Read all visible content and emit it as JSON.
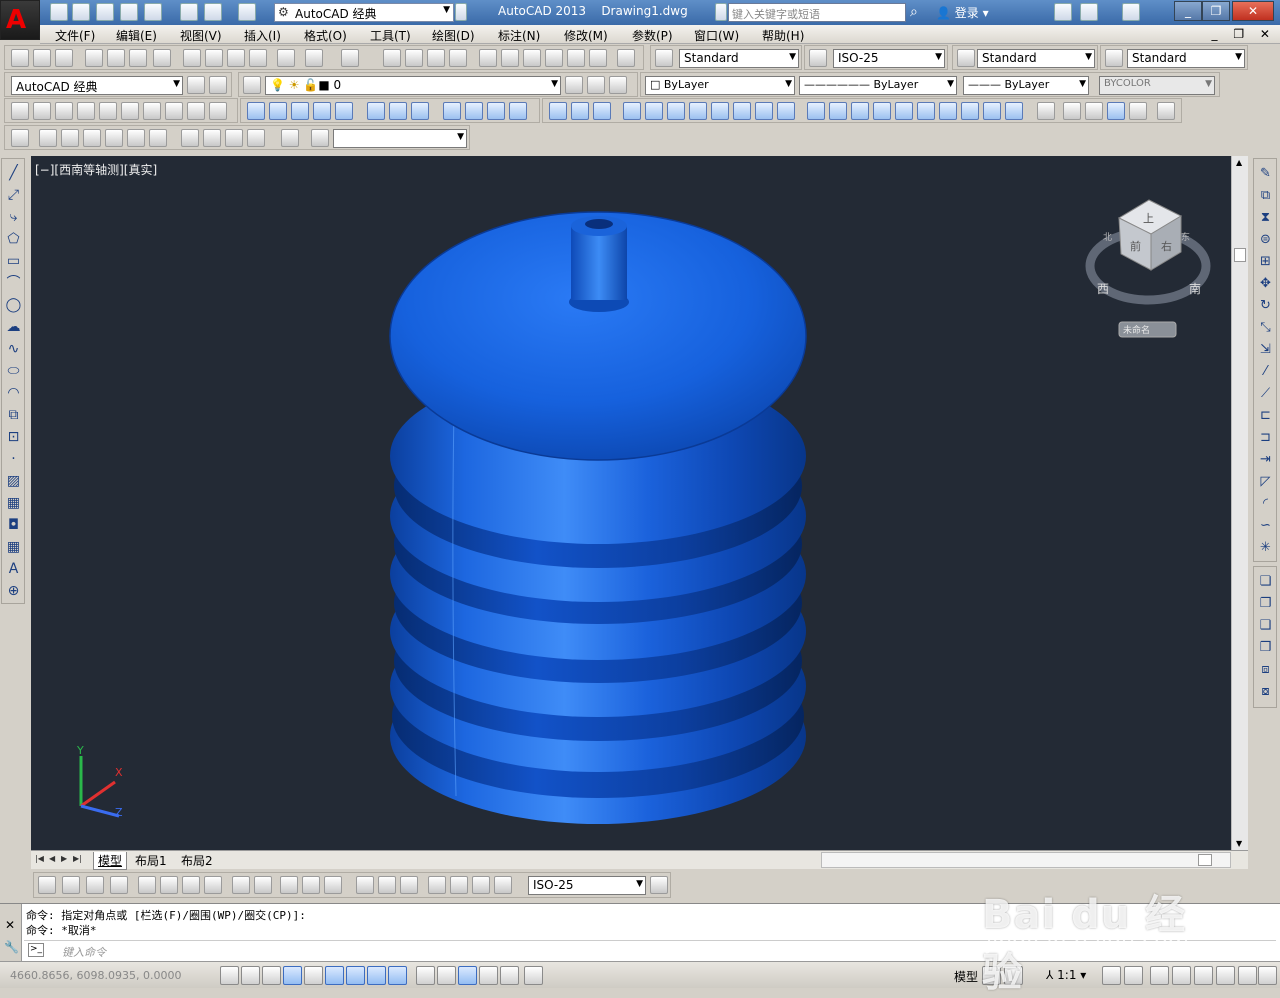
{
  "titlebar": {
    "workspace": "AutoCAD 经典",
    "app_title": "AutoCAD 2013",
    "doc_title": "Drawing1.dwg",
    "search_placeholder": "键入关键字或短语",
    "login_label": "登录"
  },
  "menubar": {
    "items": [
      "文件(F)",
      "编辑(E)",
      "视图(V)",
      "插入(I)",
      "格式(O)",
      "工具(T)",
      "绘图(D)",
      "标注(N)",
      "修改(M)",
      "参数(P)",
      "窗口(W)",
      "帮助(H)"
    ]
  },
  "toolbar_styles": {
    "text_style": "Standard",
    "dim_style": "ISO-25",
    "table_style": "Standard",
    "multileader_style": "Standard"
  },
  "toolbar_layers": {
    "workspace": "AutoCAD 经典",
    "layer": "0",
    "color": "ByLayer",
    "linetype": "ByLayer",
    "lineweight": "ByLayer",
    "plotstyle": "BYCOLOR"
  },
  "viewport": {
    "label": "[−][西南等轴测][真实]",
    "viewcube_top": "上",
    "viewcube_front": "前",
    "viewcube_right": "右",
    "compass_w": "西",
    "compass_s": "南",
    "compass_e": "东",
    "compass_n": "北",
    "ucs_name": "未命名",
    "axis_x": "X",
    "axis_y": "Y",
    "axis_z": "Z",
    "object_color": "#1a6be8"
  },
  "layout_tabs": [
    "模型",
    "布局1",
    "布局2"
  ],
  "dim_toolbar": {
    "dim_style": "ISO-25"
  },
  "command": {
    "history": [
      "命令: 指定对角点或 [栏选(F)/圈围(WP)/圈交(CP)]:",
      "命令: *取消*"
    ],
    "placeholder": "键入命令"
  },
  "statusbar": {
    "coords": "4660.8656, 6098.0935, 0.0000",
    "model_label": "模型",
    "scale": "1:1"
  },
  "watermark": {
    "main": "Bai du 经验",
    "sub": "jingyan.baidu.com"
  }
}
